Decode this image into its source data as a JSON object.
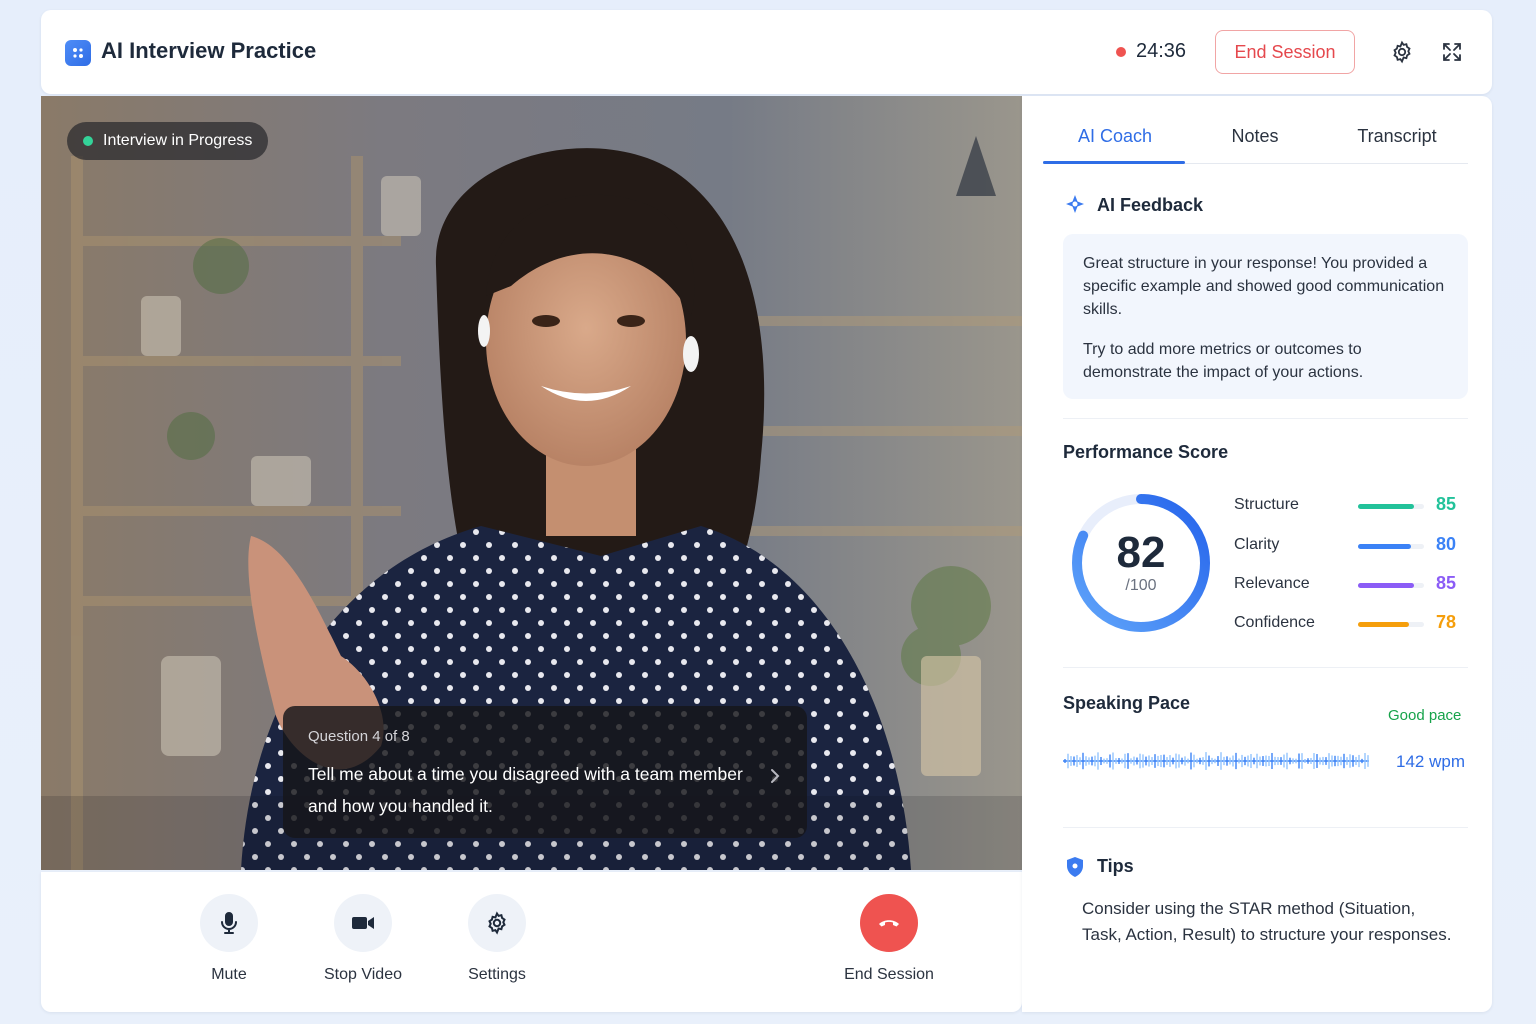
{
  "header": {
    "app_title": "AI Interview Practice",
    "timer": "24:36",
    "end_session_label": "End Session",
    "icons": [
      "settings-icon",
      "fullscreen-icon"
    ],
    "colors": {
      "accent": "#2f6de6",
      "recording": "#ef5350",
      "danger": "#e5484d"
    }
  },
  "video": {
    "status_badge": "Interview in Progress",
    "question_label": "Question 4 of 8",
    "question_text": "Tell me about a time you disagreed with a team member and how you handled it."
  },
  "controls": [
    {
      "label": "Mute",
      "icon": "microphone-icon"
    },
    {
      "label": "Stop Video",
      "icon": "video-camera-icon"
    },
    {
      "label": "Settings",
      "icon": "gear-icon"
    },
    {
      "label": "End Session",
      "icon": "hang-up-icon"
    }
  ],
  "panel": {
    "tabs": [
      {
        "label": "AI Coach",
        "active": true
      },
      {
        "label": "Notes",
        "active": false
      },
      {
        "label": "Transcript",
        "active": false
      }
    ],
    "feedback": {
      "title": "AI Feedback",
      "paragraph_1": "Great structure in your response! You provided a specific example and showed good communication skills.",
      "paragraph_2": "Try to add more metrics or outcomes to demonstrate the impact of your actions."
    },
    "performance": {
      "title": "Performance Score",
      "score": "82",
      "score_max": "/100",
      "score_fraction": 0.82,
      "metrics": [
        {
          "name": "Structure",
          "value": "85",
          "fraction": 0.85,
          "color": "#22c29a"
        },
        {
          "name": "Clarity",
          "value": "80",
          "fraction": 0.8,
          "color": "#3b82f6"
        },
        {
          "name": "Relevance",
          "value": "85",
          "fraction": 0.85,
          "color": "#8b5cf6"
        },
        {
          "name": "Confidence",
          "value": "78",
          "fraction": 0.78,
          "color": "#f59e0b"
        }
      ]
    },
    "pace": {
      "title": "Speaking Pace",
      "status": "Good pace",
      "value": "142 wpm"
    },
    "tips": {
      "title": "Tips",
      "text": "Consider using the STAR method (Situation, Task, Action, Result) to structure your responses."
    }
  }
}
